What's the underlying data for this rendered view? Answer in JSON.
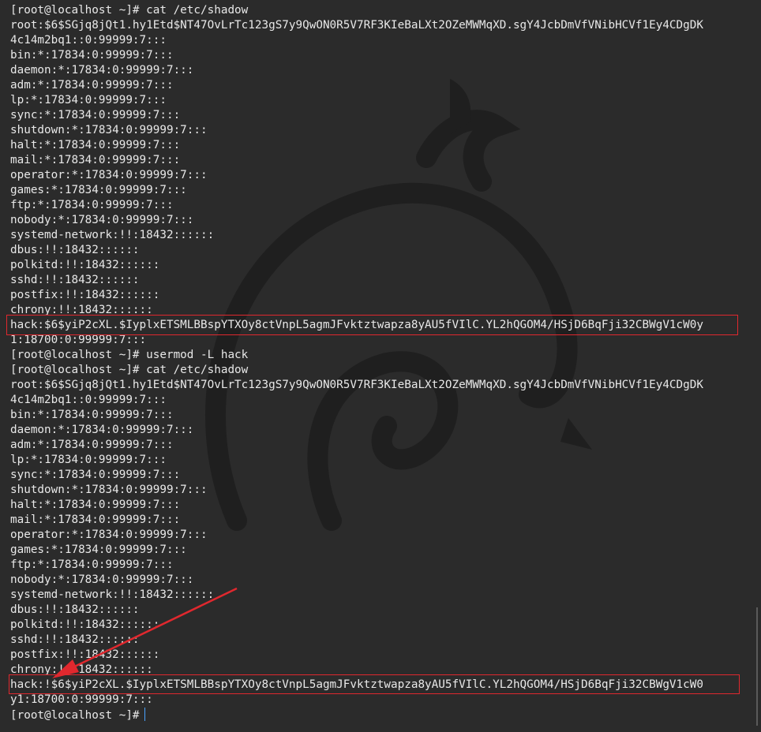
{
  "terminal": {
    "lines": [
      "[root@localhost ~]# cat /etc/shadow",
      "root:$6$SGjq8jQt1.hy1Etd$NT47OvLrTc123gS7y9QwON0R5V7RF3KIeBaLXt2OZeMWMqXD.sgY4JcbDmVfVNibHCVf1Ey4CDgDK",
      "4c14m2bq1::0:99999:7:::",
      "bin:*:17834:0:99999:7:::",
      "daemon:*:17834:0:99999:7:::",
      "adm:*:17834:0:99999:7:::",
      "lp:*:17834:0:99999:7:::",
      "sync:*:17834:0:99999:7:::",
      "shutdown:*:17834:0:99999:7:::",
      "halt:*:17834:0:99999:7:::",
      "mail:*:17834:0:99999:7:::",
      "operator:*:17834:0:99999:7:::",
      "games:*:17834:0:99999:7:::",
      "ftp:*:17834:0:99999:7:::",
      "nobody:*:17834:0:99999:7:::",
      "systemd-network:!!:18432::::::",
      "dbus:!!:18432::::::",
      "polkitd:!!:18432::::::",
      "sshd:!!:18432::::::",
      "postfix:!!:18432::::::",
      "chrony:!!:18432::::::",
      "hack:$6$yiP2cXL.$IyplxETSMLBBspYTXOy8ctVnpL5agmJFvktztwapza8yAU5fVIlC.YL2hQGOM4/HSjD6BqFji32CBWgV1cW0y",
      "1:18700:0:99999:7:::",
      "[root@localhost ~]# usermod -L hack",
      "[root@localhost ~]# cat /etc/shadow",
      "root:$6$SGjq8jQt1.hy1Etd$NT47OvLrTc123gS7y9QwON0R5V7RF3KIeBaLXt2OZeMWMqXD.sgY4JcbDmVfVNibHCVf1Ey4CDgDK",
      "4c14m2bq1::0:99999:7:::",
      "bin:*:17834:0:99999:7:::",
      "daemon:*:17834:0:99999:7:::",
      "adm:*:17834:0:99999:7:::",
      "lp:*:17834:0:99999:7:::",
      "sync:*:17834:0:99999:7:::",
      "shutdown:*:17834:0:99999:7:::",
      "halt:*:17834:0:99999:7:::",
      "mail:*:17834:0:99999:7:::",
      "operator:*:17834:0:99999:7:::",
      "games:*:17834:0:99999:7:::",
      "ftp:*:17834:0:99999:7:::",
      "nobody:*:17834:0:99999:7:::",
      "systemd-network:!!:18432::::::",
      "dbus:!!:18432::::::",
      "polkitd:!!:18432::::::",
      "sshd:!!:18432::::::",
      "postfix:!!:18432::::::",
      "chrony:!!:18432::::::",
      "hack:!$6$yiP2cXL.$IyplxETSMLBBspYTXOy8ctVnpL5agmJFvktztwapza8yAU5fVIlC.YL2hQGOM4/HSjD6BqFji32CBWgV1cW0",
      "y1:18700:0:99999:7:::",
      "[root@localhost ~]#"
    ]
  },
  "colors": {
    "background": "#2b2b2b",
    "text": "#e8e8e8",
    "highlight": "#e0282e",
    "cursor": "#4aa3ff"
  },
  "icons": {
    "watermark": "kali-dragon-icon",
    "annotation": "red-arrow-icon"
  }
}
